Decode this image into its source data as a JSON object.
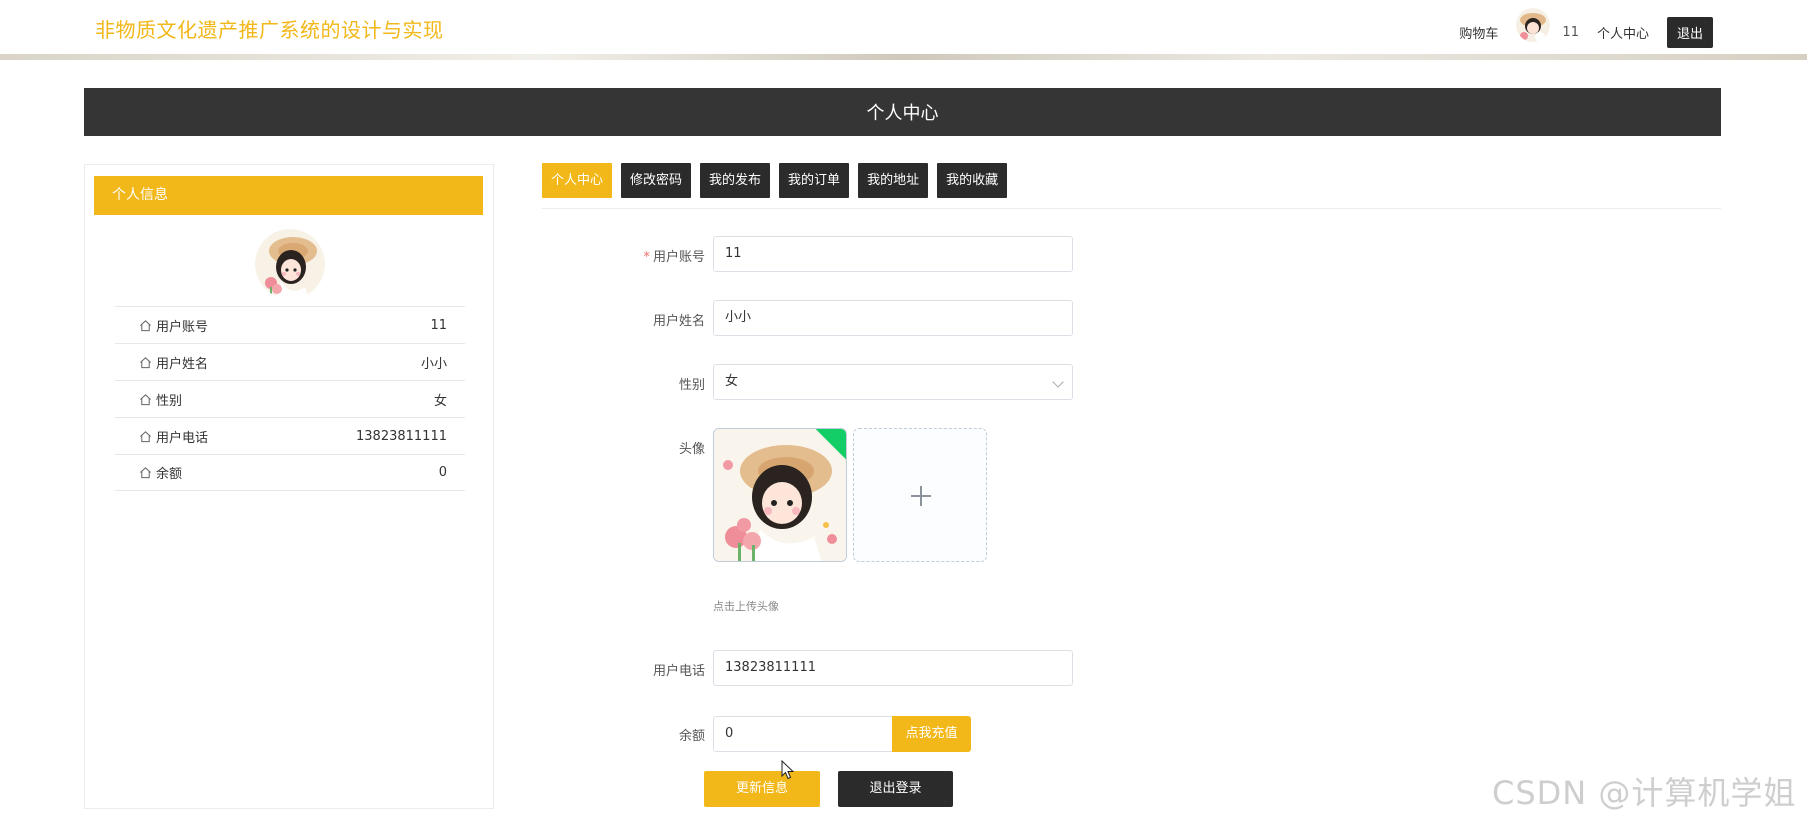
{
  "site": {
    "title": "非物质文化遗产推广系统的设计与实现"
  },
  "top_nav": {
    "cart": "购物车",
    "username": "11",
    "profile_link": "个人中心",
    "logout": "退出"
  },
  "banner": {
    "title": "个人中心"
  },
  "sidebar": {
    "header": "个人信息",
    "items": [
      {
        "icon": "home-icon",
        "label": "用户账号",
        "value": "11"
      },
      {
        "icon": "home-icon",
        "label": "用户姓名",
        "value": "小小"
      },
      {
        "icon": "home-icon",
        "label": "性别",
        "value": "女"
      },
      {
        "icon": "home-icon",
        "label": "用户电话",
        "value": "13823811111"
      },
      {
        "icon": "home-icon",
        "label": "余额",
        "value": "0"
      }
    ]
  },
  "tabs": [
    {
      "label": "个人中心",
      "active": true
    },
    {
      "label": "修改密码",
      "active": false
    },
    {
      "label": "我的发布",
      "active": false
    },
    {
      "label": "我的订单",
      "active": false
    },
    {
      "label": "我的地址",
      "active": false
    },
    {
      "label": "我的收藏",
      "active": false
    }
  ],
  "form": {
    "account": {
      "label": "用户账号",
      "value": "11",
      "required": "*"
    },
    "name": {
      "label": "用户姓名",
      "value": "小小"
    },
    "gender": {
      "label": "性别",
      "value": "女"
    },
    "avatar": {
      "label": "头像",
      "tip": "点击上传头像"
    },
    "phone": {
      "label": "用户电话",
      "value": "13823811111"
    },
    "balance": {
      "label": "余额",
      "value": "0",
      "recharge": "点我充值"
    },
    "update_button": "更新信息",
    "logout_button": "退出登录"
  },
  "watermark": "CSDN @计算机学姐",
  "colors": {
    "accent": "#f2b718",
    "dark": "#2b2b2b",
    "banner": "#353535",
    "success": "#13ce66"
  }
}
